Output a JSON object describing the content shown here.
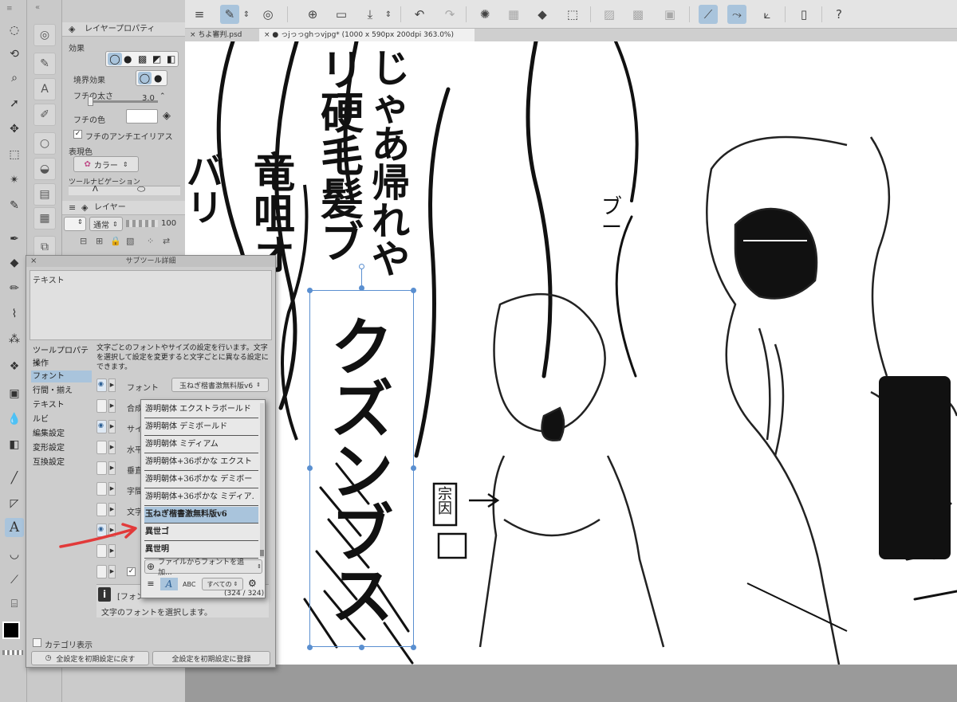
{
  "tabs": [
    {
      "label": "× ちよ審判.psd",
      "active": false
    },
    {
      "label": "× ● っjっっghっvjpg* (1000 x 590px 200dpi 363.0%)",
      "active": true
    }
  ],
  "layer_property": {
    "title": "レイヤープロパティ",
    "effect_label": "効果",
    "border_effect_label": "境界効果",
    "border_width_label": "フチの太さ",
    "border_width_value": "3.0",
    "border_color_label": "フチの色",
    "antialias_label": "フチのアンチエイリアス",
    "expression_color_label": "表現色",
    "expression_color_value": "カラー",
    "tool_navigation_label": "ツールナビゲーション"
  },
  "layer_panel": {
    "title": "レイヤー",
    "blend_mode": "通常",
    "opacity": "100"
  },
  "subtool_detail": {
    "title": "サブツール詳細",
    "tool_name": "テキスト",
    "categories": [
      "ツールプロパティ",
      "操作",
      "フォント",
      "行間・揃え",
      "テキスト",
      "ルビ",
      "編集設定",
      "変形設定",
      "互換設定"
    ],
    "selected_category": "フォント",
    "description": "文字ごとのフォントやサイズの設定を行います。文字を選択して設定を変更すると文字ごとに異なる設定にできます。",
    "font_label": "フォント",
    "font_value": "玉ねぎ楷書激無料版v6",
    "row_labels": [
      "合成",
      "サイ",
      "水平",
      "垂直",
      "字間",
      "文字"
    ],
    "info_label": "[フォン",
    "info_desc": "文字のフォントを選択します。",
    "category_display_label": "カテゴリ表示",
    "reset_all_button": "全設定を初期設定に戻す",
    "register_all_button": "全設定を初期設定に登録"
  },
  "font_list": {
    "items": [
      "游明朝体 エクストラボールド",
      "游明朝体 デミボールド",
      "游明朝体 ミディアム",
      "游明朝体+36ポかな エクスト",
      "游明朝体+36ポかな デミボー",
      "游明朝体+36ポかな ミディア.",
      "玉ねぎ楷書激無料版v6",
      "異世ゴ",
      "異世明"
    ],
    "selected": "玉ねぎ楷書激無料版v6",
    "add_from_file": "ファイルからフォントを追加...",
    "filter_value": "すべての",
    "abc_label": "ABC",
    "count": "(324 / 324)"
  },
  "canvas_text": {
    "col1": "じゃあ帰れや",
    "col2": "リ硬毛髪ブ",
    "col3": "竜咀オ",
    "col4": "バリ",
    "selected_text": "クズンブス",
    "small_sfx": "ブー",
    "sign_label": "宗因"
  }
}
